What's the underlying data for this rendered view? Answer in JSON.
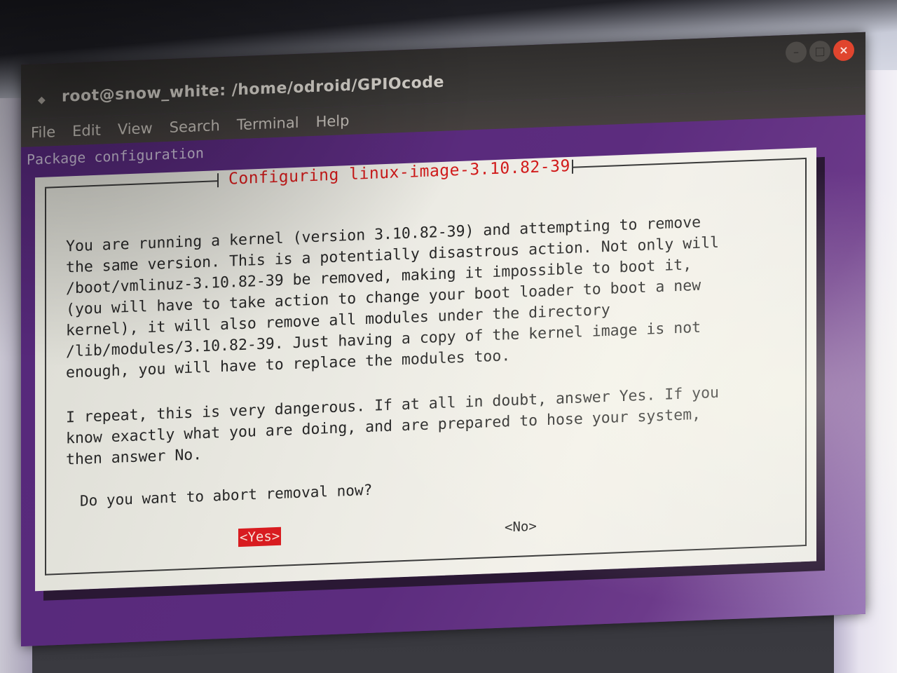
{
  "window": {
    "title": "root@snow_white: /home/odroid/GPIOcode",
    "title_icon": "terminal-icon",
    "controls": {
      "minimize_icon": "minimize-icon",
      "maximize_icon": "maximize-icon",
      "close_icon": "close-icon",
      "minimize_glyph": "–",
      "maximize_glyph": "□",
      "close_glyph": "×"
    },
    "menu": [
      "File",
      "Edit",
      "View",
      "Search",
      "Terminal",
      "Help"
    ]
  },
  "terminal": {
    "header_line": "Package configuration"
  },
  "dialog": {
    "title": "Configuring linux-image-3.10.82-39",
    "paragraph1": "You are running a kernel (version 3.10.82-39) and attempting to remove\nthe same version. This is a potentially disastrous action. Not only will\n/boot/vmlinuz-3.10.82-39 be removed, making it impossible to boot it,\n(you will have to take action to change your boot loader to boot a new\nkernel), it will also remove all modules under the directory\n/lib/modules/3.10.82-39. Just having a copy of the kernel image is not\nenough, you will have to replace the modules too.",
    "paragraph2": "I repeat, this is very dangerous. If at all in doubt, answer Yes. If you\nknow exactly what you are doing, and are prepared to hose your system,\nthen answer No.",
    "question": "Do you want to abort removal now?",
    "yes_label": "<Yes>",
    "no_label": "<No>"
  },
  "colors": {
    "terminal_bg": "#5a2a72",
    "dialog_bg": "#ecebe4",
    "dialog_title": "#d11a1a",
    "selected_button_bg": "#d81c20",
    "close_button": "#e0452e"
  }
}
